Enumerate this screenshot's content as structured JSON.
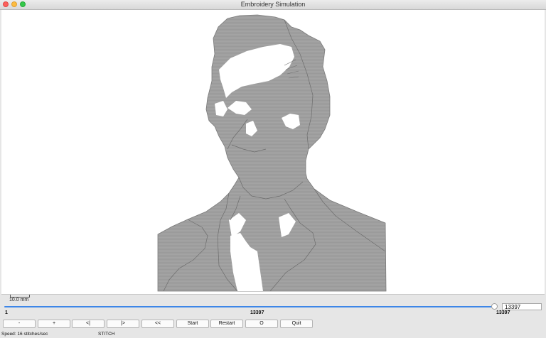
{
  "window": {
    "title": "Embroidery Simulation"
  },
  "canvas": {
    "scale_label": "10.0 mm",
    "fill_color": "#a2a2a2",
    "outline_color": "#6a6a6a"
  },
  "slider": {
    "min_label": "1",
    "current_label": "13397",
    "max_label": "13397",
    "value_field": "13397",
    "track_color": "#3d86e8",
    "progress": 1.0
  },
  "buttons": {
    "minus": "-",
    "plus": "+",
    "step_back": "<|",
    "step_forward": "|>",
    "rewind": "<<",
    "start": "Start",
    "restart": "Restart",
    "o": "O",
    "quit": "Quit"
  },
  "status": {
    "speed": "Speed: 16 stitches/sec",
    "mode": "STITCH"
  }
}
